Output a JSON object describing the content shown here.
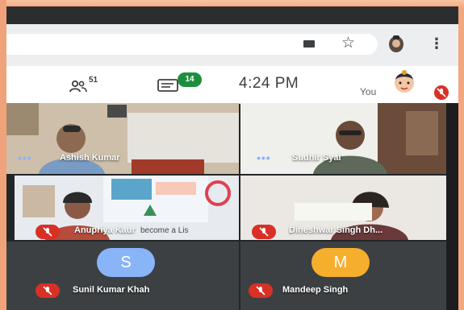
{
  "toolbar": {
    "people_count": "51",
    "chat_badge": "14",
    "time": "4:24 PM",
    "self_label": "You"
  },
  "participants": [
    {
      "name": "Ashish Kumar",
      "state": "more-options"
    },
    {
      "name": "Sudhir Syal",
      "state": "more-options"
    },
    {
      "name": "Anupriya Kaur",
      "state": "muted",
      "background_text": "become a Lis"
    },
    {
      "name": "Dineshwar Singh Dh...",
      "state": "muted"
    },
    {
      "name": "Sunil Kumar Khah",
      "state": "muted",
      "initial": "S",
      "avatar_color": "#8ab4f8"
    },
    {
      "name": "Mandeep Singh",
      "state": "muted",
      "initial": "M",
      "avatar_color": "#f6ae2d"
    }
  ],
  "colors": {
    "mute_red": "#d93025",
    "chat_green": "#1e8e3e",
    "tile_bg": "#3c4043"
  }
}
